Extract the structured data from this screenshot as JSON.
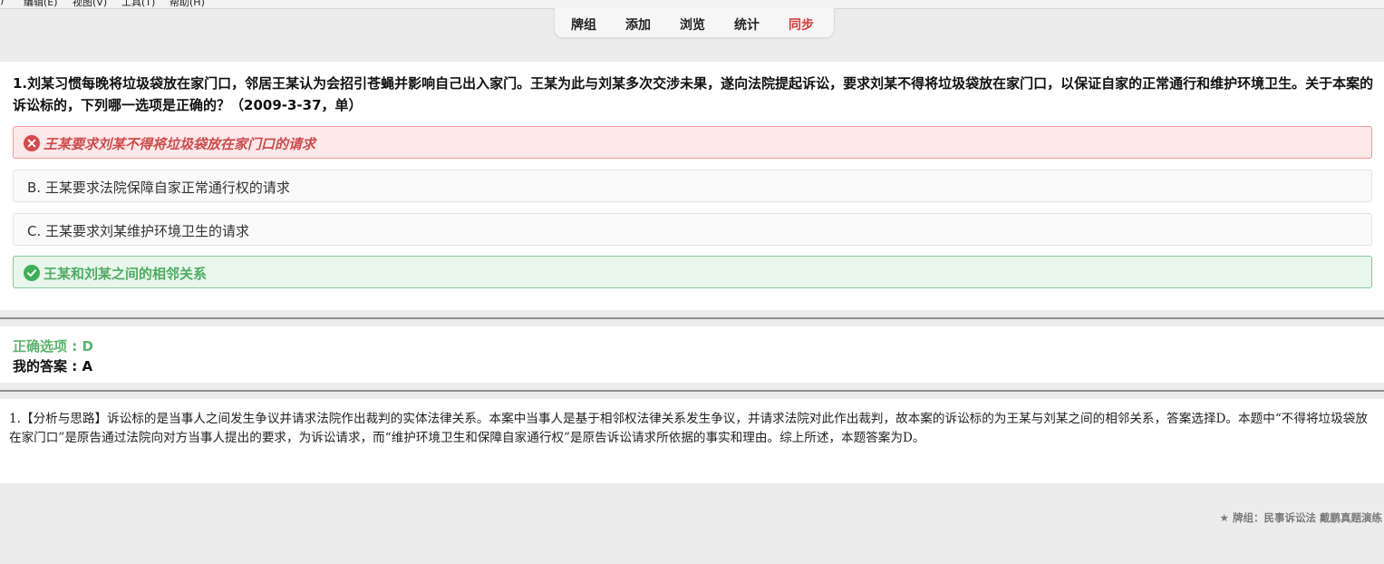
{
  "menu": [
    {
      "label": "编辑(E)"
    },
    {
      "label": "视图(V)"
    },
    {
      "label": "工具(T)"
    },
    {
      "label": "帮助(H)"
    }
  ],
  "toolbar": {
    "decks": "牌组",
    "add": "添加",
    "browse": "浏览",
    "stats": "统计",
    "sync": "同步",
    "sync_color": "#d43b3b"
  },
  "question": {
    "text": "1.刘某习惯每晚将垃圾袋放在家门口，邻居王某认为会招引苍蝇并影响自己出入家门。王某为此与刘某多次交涉未果，遂向法院提起诉讼，要求刘某不得将垃圾袋放在家门口，以保证自家的正常通行和维护环境卫生。关于本案的诉讼标的，下列哪一选项是正确的？（2009-3-37，单）",
    "options": [
      {
        "text": "王某要求刘某不得将垃圾袋放在家门口的请求",
        "state": "wrong",
        "icon": "cross-circle-icon"
      },
      {
        "text": "B. 王某要求法院保障自家正常通行权的请求",
        "state": "normal"
      },
      {
        "text": "C. 王某要求刘某维护环境卫生的请求",
        "state": "normal"
      },
      {
        "text": "王某和刘某之间的相邻关系",
        "state": "correct",
        "icon": "check-circle-icon"
      }
    ]
  },
  "answers": {
    "correct": "正确选项 : D",
    "mine": "我的答案 : A"
  },
  "analysis": {
    "text": "1.【分析与思路】诉讼标的是当事人之间发生争议并请求法院作出裁判的实体法律关系。本案中当事人是基于相邻权法律关系发生争议，并请求法院对此作出裁判，故本案的诉讼标的为王某与刘某之间的相邻关系，答案选择D。本题中“不得将垃圾袋放在家门口”是原告通过法院向对方当事人提出的要求，为诉讼请求，而“维护环境卫生和保障自家通行权”是原告诉讼请求所依据的事实和理由。综上所述，本题答案为D。"
  },
  "footer": {
    "deck": "★ 牌组：民事诉讼法 戴鹏真题演练"
  },
  "colors": {
    "wrong": "#cf4b4b",
    "correct": "#4fab63",
    "background": "#ececec"
  }
}
